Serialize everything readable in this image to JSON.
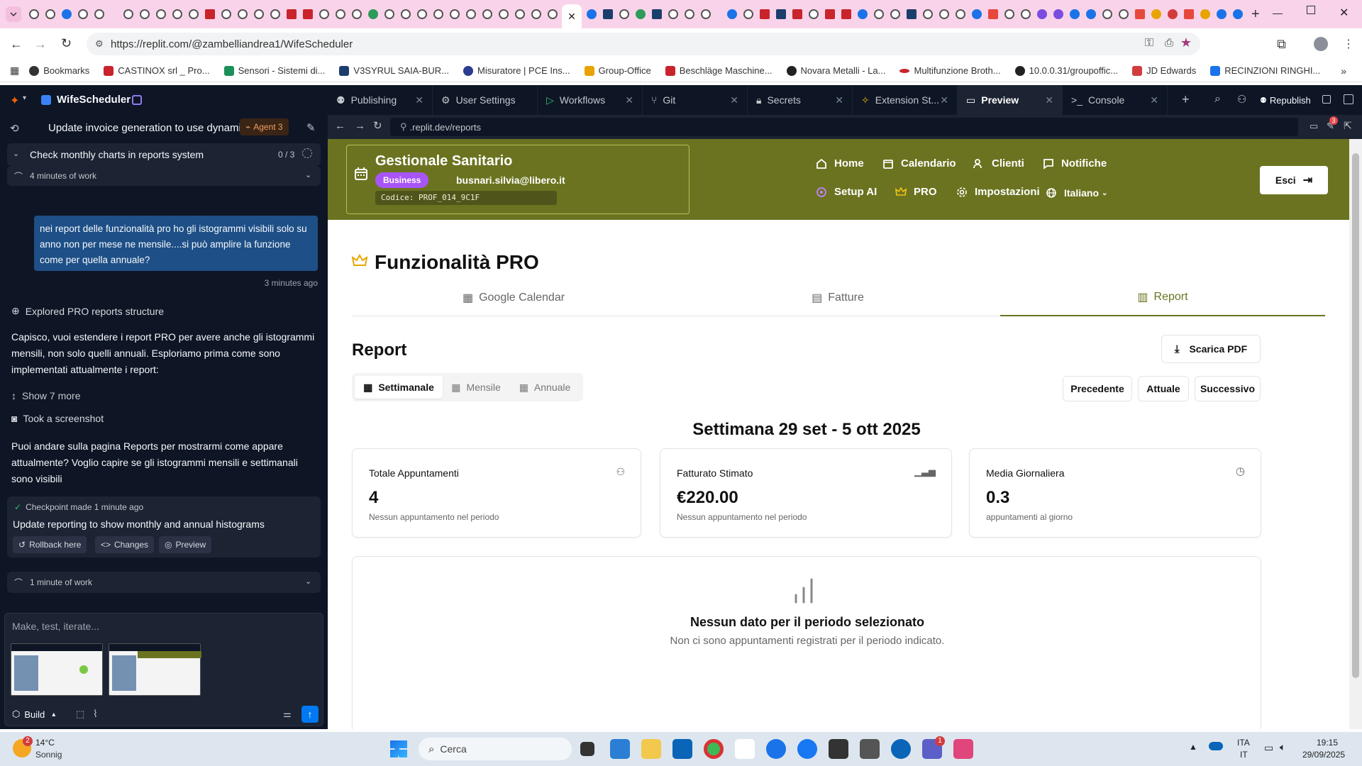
{
  "browser": {
    "url": "https://replit.com/@zambelliandrea1/WifeScheduler",
    "bookmarks": [
      "Bookmarks",
      "CASTINOX srl _ Pro...",
      "Sensori - Sistemi di...",
      "V3SYRUL SAIA-BUR...",
      "Misuratore | PCE Ins...",
      "Group-Office",
      "Beschläge Maschine...",
      "Novara Metalli - La...",
      "Multifunzione Broth...",
      "10.0.0.31/groupoffic...",
      "JD Edwards",
      "RECINZIONI RINGHI..."
    ],
    "colors": {
      "tabstrip": "#f9d3e9",
      "accent": "#6b7320"
    }
  },
  "replit": {
    "project_name": "WifeScheduler",
    "tabs": [
      "Publishing",
      "User Settings",
      "Workflows",
      "Git",
      "Secrets",
      "Extension St...",
      "Preview",
      "Console"
    ],
    "republish_label": "Republish",
    "thread_title": "Update invoice generation to use dynami...",
    "agent_label": "Agent 3",
    "task_title": "Check monthly charts in reports system",
    "task_progress": "0 / 3",
    "work_1": "4 minutes of work",
    "user_message": "nei report delle funzionalità pro ho gli istogrammi visibili solo su anno non per mese ne mensile....si può amplire la funzione come per quella annuale?",
    "user_message_time": "3 minutes ago",
    "explored_label": "Explored PRO reports structure",
    "agent_reply": "Capisco, vuoi estendere i report PRO per avere anche gli istogrammi mensili, non solo quelli annuali. Esploriamo prima come sono implementati attualmente i report:",
    "show_more": "Show 7 more",
    "screenshot_label": "Took a screenshot",
    "agent_reply_2": "Puoi andare sulla pagina Reports per mostrarmi come appare attualmente? Voglio capire se gli istogrammi mensili e settimanali sono visibili",
    "checkpoint": "Checkpoint made 1 minute ago",
    "checkpoint_title": "Update reporting to show monthly and annual histograms",
    "rollback": "Rollback here",
    "changes": "Changes",
    "preview": "Preview",
    "work_2": "1 minute of work",
    "input_placeholder": "Make, test, iterate...",
    "build_label": "Build",
    "preview_url": ".replit.dev/reports",
    "notification_count": "3"
  },
  "app": {
    "brand": "Gestionale Sanitario",
    "badge": "Business",
    "email": "busnari.silvia@libero.it",
    "code": "Codice: PROF_014_9C1F",
    "nav": [
      "Home",
      "Calendario",
      "Clienti",
      "Notifiche",
      "Setup AI",
      "PRO",
      "Impostazioni",
      "Italiano"
    ],
    "logout": "Esci",
    "page_title": "Funzionalità PRO",
    "pro_tabs": [
      "Google Calendar",
      "Fatture",
      "Report"
    ],
    "report_title": "Report",
    "download_pdf": "Scarica PDF",
    "period_tabs": [
      "Settimanale",
      "Mensile",
      "Annuale"
    ],
    "nav_buttons": [
      "Precedente",
      "Attuale",
      "Successivo"
    ],
    "period_heading": "Settimana 29 set - 5 ott 2025",
    "stats": [
      {
        "label": "Totale Appuntamenti",
        "value": "4",
        "sub": "Nessun appuntamento nel periodo"
      },
      {
        "label": "Fatturato Stimato",
        "value": "€220.00",
        "sub": "Nessun appuntamento nel periodo"
      },
      {
        "label": "Media Giornaliera",
        "value": "0.3",
        "sub": "appuntamenti al giorno"
      }
    ],
    "empty_title": "Nessun dato per il periodo selezionato",
    "empty_sub": "Non ci sono appuntamenti registrati per il periodo indicato."
  },
  "taskbar": {
    "weather_temp": "14°C",
    "weather_desc": "Sonnig",
    "weather_badge": "2",
    "search": "Cerca",
    "lang_1": "ITA",
    "lang_2": "IT",
    "time": "19:15",
    "date": "29/09/2025",
    "teams_badge": "1"
  }
}
